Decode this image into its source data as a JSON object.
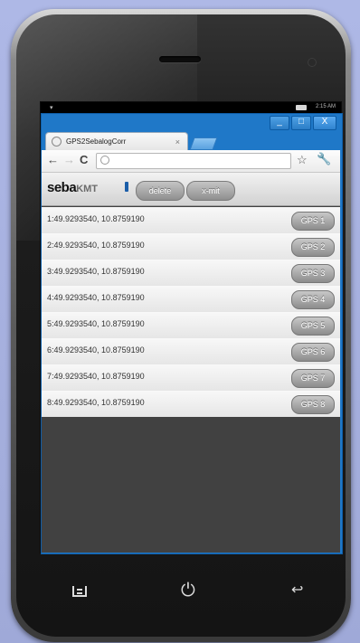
{
  "status_bar": {
    "time": "2:15 AM"
  },
  "window": {
    "minimize_label": "_",
    "maximize_label": "□",
    "close_label": "X"
  },
  "browser": {
    "tab_title": "GPS2SebalogCorr",
    "tab_close": "×",
    "back_label": "←",
    "forward_label": "→",
    "reload_label": "C",
    "url": "",
    "star_label": "☆",
    "wrench_label": "🔧"
  },
  "app": {
    "logo_primary": "seba",
    "logo_secondary": "KMT",
    "delete_label": "delete",
    "xmit_label": "x-mit",
    "rows": [
      {
        "coord": "1:49.9293540, 10.8759190",
        "button": "GPS 1"
      },
      {
        "coord": "2:49.9293540, 10.8759190",
        "button": "GPS 2"
      },
      {
        "coord": "3:49.9293540, 10.8759190",
        "button": "GPS 3"
      },
      {
        "coord": "4:49.9293540, 10.8759190",
        "button": "GPS 4"
      },
      {
        "coord": "5:49.9293540, 10.8759190",
        "button": "GPS 5"
      },
      {
        "coord": "6:49.9293540, 10.8759190",
        "button": "GPS 6"
      },
      {
        "coord": "7:49.9293540, 10.8759190",
        "button": "GPS 7"
      },
      {
        "coord": "8:49.9293540, 10.8759190",
        "button": "GPS 8"
      }
    ]
  },
  "android_nav": {
    "power_glyph": "⏻",
    "back_glyph": "↩"
  }
}
